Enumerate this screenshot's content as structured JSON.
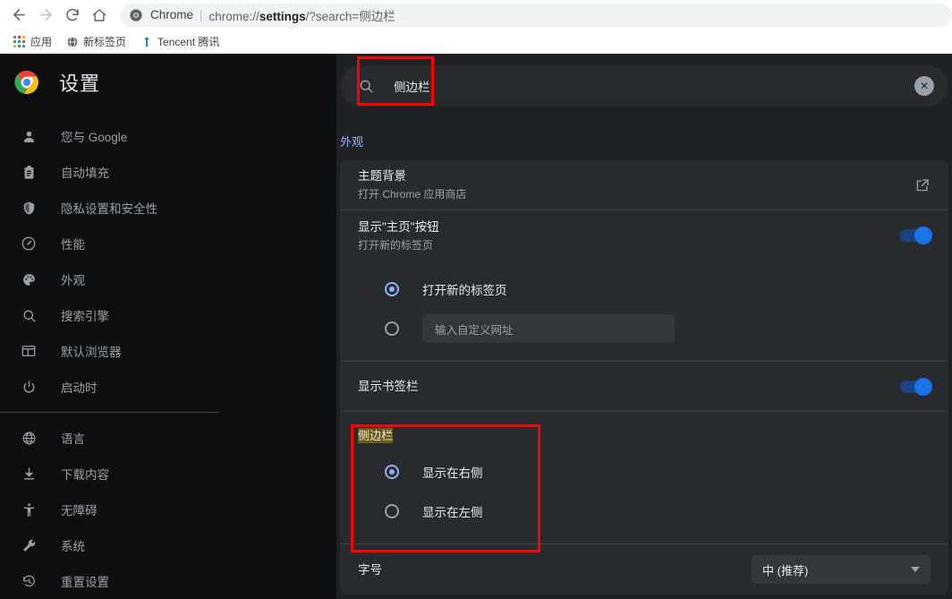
{
  "browser": {
    "nav": {
      "back": "back-arrow",
      "forward": "forward-arrow",
      "reload": "reload",
      "home": "home"
    },
    "omnibox": {
      "site_label": "Chrome",
      "separator": "|",
      "url_prefix": "chrome://",
      "url_bold": "settings",
      "url_suffix": "/?search=侧边栏"
    },
    "bookmarks": [
      {
        "label": "应用",
        "icon": "apps-grid-icon"
      },
      {
        "label": "新标签页",
        "icon": "globe-icon"
      },
      {
        "label": "Tencent 腾讯",
        "icon": "tencent-icon"
      }
    ]
  },
  "sidebar": {
    "title": "设置",
    "logo": "chrome-logo",
    "items": [
      {
        "label": "您与 Google",
        "icon": "person-icon"
      },
      {
        "label": "自动填充",
        "icon": "clipboard-icon"
      },
      {
        "label": "隐私设置和安全性",
        "icon": "shield-icon"
      },
      {
        "label": "性能",
        "icon": "speedometer-icon"
      },
      {
        "label": "外观",
        "icon": "palette-icon"
      },
      {
        "label": "搜索引擎",
        "icon": "search-icon"
      },
      {
        "label": "默认浏览器",
        "icon": "browser-window-icon"
      },
      {
        "label": "启动时",
        "icon": "power-icon"
      }
    ],
    "items_group2": [
      {
        "label": "语言",
        "icon": "globe-icon"
      },
      {
        "label": "下载内容",
        "icon": "download-icon"
      },
      {
        "label": "无障碍",
        "icon": "accessibility-icon"
      },
      {
        "label": "系统",
        "icon": "wrench-icon"
      },
      {
        "label": "重置设置",
        "icon": "history-restore-icon"
      }
    ]
  },
  "search": {
    "value": "侧边栏",
    "icon": "search-icon",
    "clear_icon": "clear-circle-icon",
    "clear_glyph": "✕"
  },
  "main": {
    "section_label": "外观",
    "rows": {
      "theme": {
        "title": "主题背景",
        "subtitle": "打开 Chrome 应用商店",
        "action_icon": "open-in-new-icon"
      },
      "home_button": {
        "title": "显示\"主页\"按钮",
        "subtitle": "打开新的标签页",
        "toggle_state": "on"
      },
      "home_options": [
        {
          "label": "打开新的标签页",
          "selected": true
        },
        {
          "label": "",
          "selected": false,
          "input_placeholder": "输入自定义网址"
        }
      ],
      "bookmarks_bar": {
        "title": "显示书签栏",
        "toggle_state": "on"
      },
      "side_panel": {
        "group_label": "侧边栏",
        "group_label_highlighted": true,
        "options": [
          {
            "label": "显示在右侧",
            "selected": true
          },
          {
            "label": "显示在左侧",
            "selected": false
          }
        ]
      },
      "font_size": {
        "title": "字号",
        "value": "中 (推荐)",
        "caret_icon": "chevron-down-icon"
      }
    }
  },
  "annotations": {
    "highlight_color": "#ff0000",
    "boxes": [
      {
        "name": "search-input-highlight"
      },
      {
        "name": "side-panel-section-highlight"
      }
    ]
  }
}
